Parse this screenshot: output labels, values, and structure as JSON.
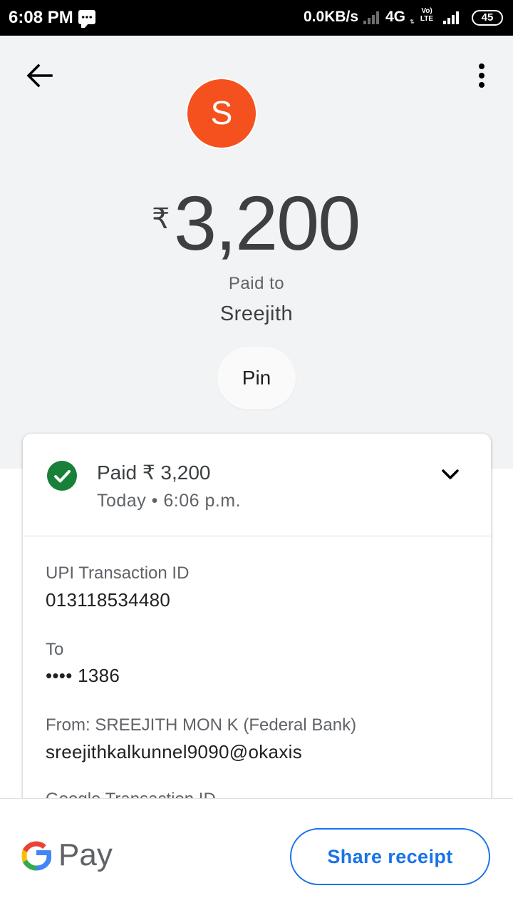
{
  "status_bar": {
    "time": "6:08 PM",
    "network_speed": "0.0KB/s",
    "network_type": "4G",
    "volte": "Vo) LTE",
    "battery": "45"
  },
  "header": {
    "back_icon": "arrow-back-icon",
    "more_icon": "more-vert-icon"
  },
  "payee": {
    "avatar_letter": "S",
    "avatar_color": "#f4511e",
    "name": "Sreejith"
  },
  "amount": {
    "currency_symbol": "₹",
    "value": "3,200",
    "paid_to_label": "Paid to"
  },
  "pin_button": "Pin",
  "transaction": {
    "status_text": "Paid ₹ 3,200",
    "status_color": "#188038",
    "timestamp": "Today • 6:06 p.m.",
    "details": [
      {
        "label": "UPI Transaction ID",
        "value": "013118534480"
      },
      {
        "label": "To",
        "value": "•••• 1386"
      },
      {
        "label": "From: SREEJITH MON K (Federal Bank)",
        "value": "sreejithkalkunnel9090@okaxis"
      },
      {
        "label": "Google Transaction ID"
      }
    ]
  },
  "footer": {
    "brand_pay": "Pay",
    "share_label": "Share receipt",
    "accent_color": "#1a73e8"
  }
}
